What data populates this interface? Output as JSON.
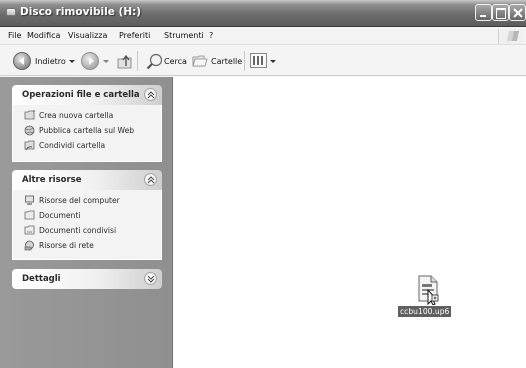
{
  "window": {
    "title": "Disco rimovibile (H:)"
  },
  "menu": {
    "items": [
      "File",
      "Modifica",
      "Visualizza",
      "Preferiti",
      "Strumenti",
      "?"
    ]
  },
  "toolbar": {
    "back_label": "Indietro",
    "search_label": "Cerca",
    "folders_label": "Cartelle"
  },
  "taskpane": {
    "sections": [
      {
        "title": "Operazioni file e cartella",
        "tasks": [
          "Crea nuova cartella",
          "Pubblica cartella sul Web",
          "Condividi cartella"
        ]
      },
      {
        "title": "Altre risorse",
        "tasks": [
          "Risorse del computer",
          "Documenti",
          "Documenti condivisi",
          "Risorse di rete"
        ]
      },
      {
        "title": "Dettagli",
        "tasks": []
      }
    ]
  },
  "content": {
    "files": [
      {
        "name": "ccbu100.up6",
        "icon": "generic-file-icon",
        "selected": true
      }
    ]
  }
}
